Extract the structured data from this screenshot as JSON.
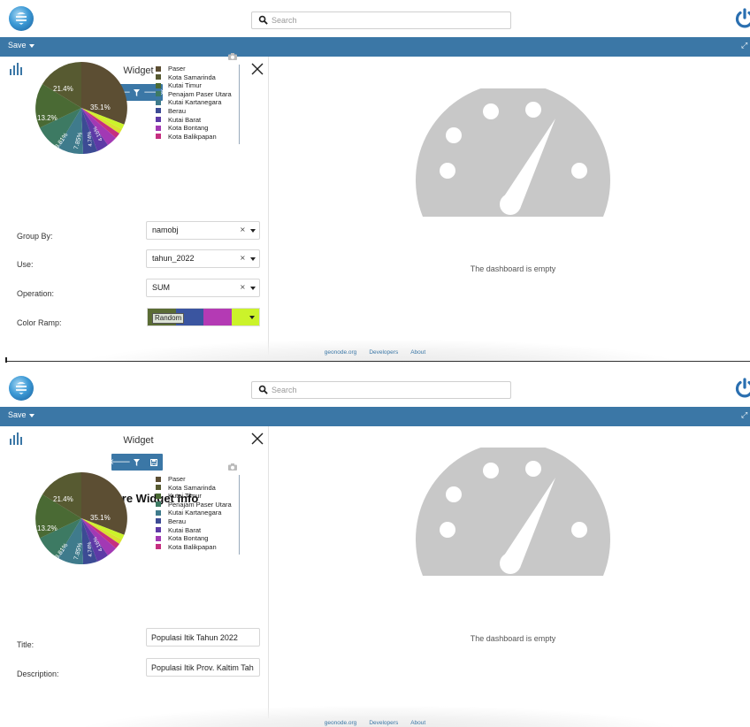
{
  "search": {
    "placeholder": "Search"
  },
  "menu": {
    "save_label": "Save"
  },
  "widget": {
    "title": "Widget",
    "config_title": "Configure Widget Info",
    "pie_labels": [
      "35.1%",
      "21.4%",
      "13.2%",
      "8.81%",
      "7.85%",
      "4.74%",
      "4.16%"
    ],
    "legend": [
      {
        "label": "Paser",
        "color": "#5c4e33"
      },
      {
        "label": "Kota Samarinda",
        "color": "#575a31"
      },
      {
        "label": "Kutai Timur",
        "color": "#4a6a34"
      },
      {
        "label": "Penajam Paser Utara",
        "color": "#3d7a63"
      },
      {
        "label": "Kutai Kartanegara",
        "color": "#3f7b8c"
      },
      {
        "label": "Berau",
        "color": "#3c4b94"
      },
      {
        "label": "Kutai Barat",
        "color": "#5d3aa6"
      },
      {
        "label": "Kota Bontang",
        "color": "#a239b4"
      },
      {
        "label": "Kota Balikpapan",
        "color": "#c62f80"
      }
    ]
  },
  "form": {
    "group_by": {
      "label": "Group By:",
      "value": "namobj"
    },
    "use": {
      "label": "Use:",
      "value": "tahun_2022"
    },
    "operation": {
      "label": "Operation:",
      "value": "SUM"
    },
    "color_ramp": {
      "label": "Color Ramp:",
      "value": "Random",
      "colors": [
        "#5a6c34",
        "#3a55a0",
        "#b43ab4",
        "#cbf32a"
      ]
    },
    "clear_symbol": "×"
  },
  "info": {
    "title_label": "Title:",
    "title_value": "Populasi Itik Tahun 2022",
    "description_label": "Description:",
    "description_value": "Populasi Itik Prov. Kaltim Tah"
  },
  "dashboard": {
    "empty_text": "The dashboard is empty"
  },
  "footer": {
    "links": [
      "geonode.org",
      "Developers",
      "About"
    ]
  },
  "colors": {
    "accent": "#3b77a6"
  }
}
